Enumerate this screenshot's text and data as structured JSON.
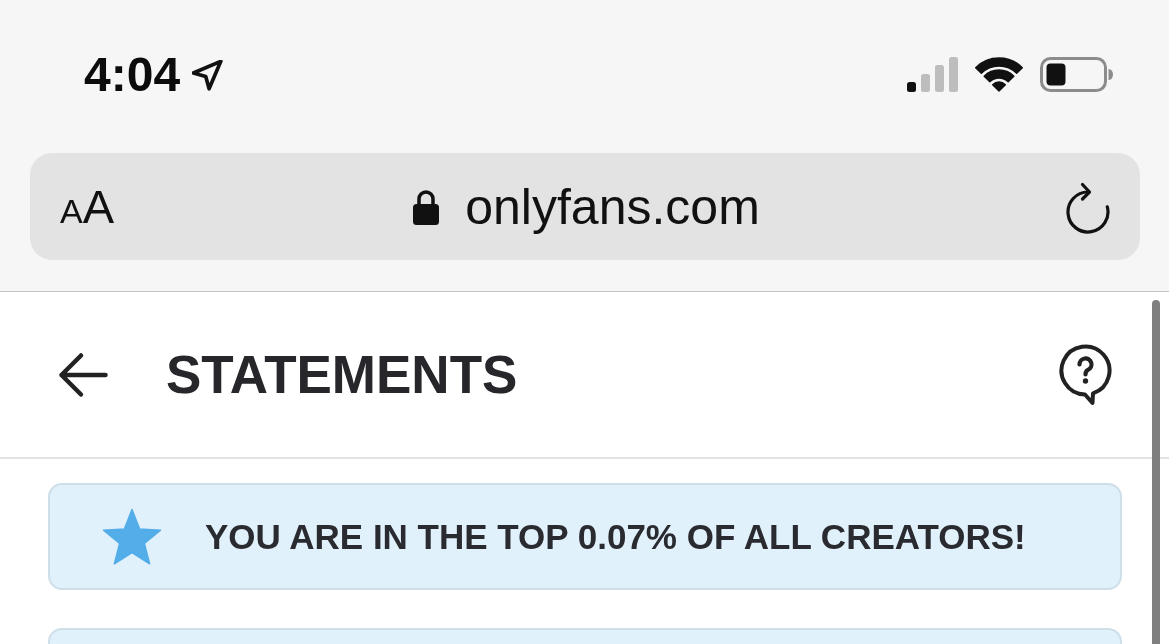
{
  "status_bar": {
    "time": "4:04"
  },
  "address_bar": {
    "text_size_button": {
      "small_letter": "A",
      "large_letter": "A"
    },
    "url": "onlyfans.com"
  },
  "header": {
    "title": "STATEMENTS"
  },
  "banner": {
    "text": "YOU ARE IN THE TOP 0.07% OF ALL CREATORS!"
  }
}
